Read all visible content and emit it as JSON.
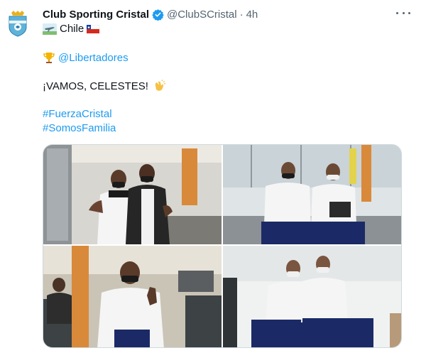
{
  "tweet": {
    "display_name": "Club Sporting Cristal",
    "handle": "@ClubSCristal",
    "separator": "·",
    "time": "4h",
    "location_text": "Chile",
    "mention": "@Libertadores",
    "cheer": "¡VAMOS, CELESTES!",
    "hashtags": [
      "#FuerzaCristal",
      "#SomosFamilia"
    ]
  },
  "colors": {
    "link": "#1d9bf0",
    "secondary_text": "#536471",
    "verified": "#1d9bf0",
    "primary_text": "#0f1419"
  },
  "icons": {
    "avatar": "sporting-cristal-crest-icon",
    "verified": "verified-badge-icon",
    "more": "more-options-icon",
    "flag": "chile-flag-icon",
    "trophy": "trophy-icon",
    "clap": "clapping-hands-icon",
    "airplane": "airplane-landscape-icon"
  }
}
